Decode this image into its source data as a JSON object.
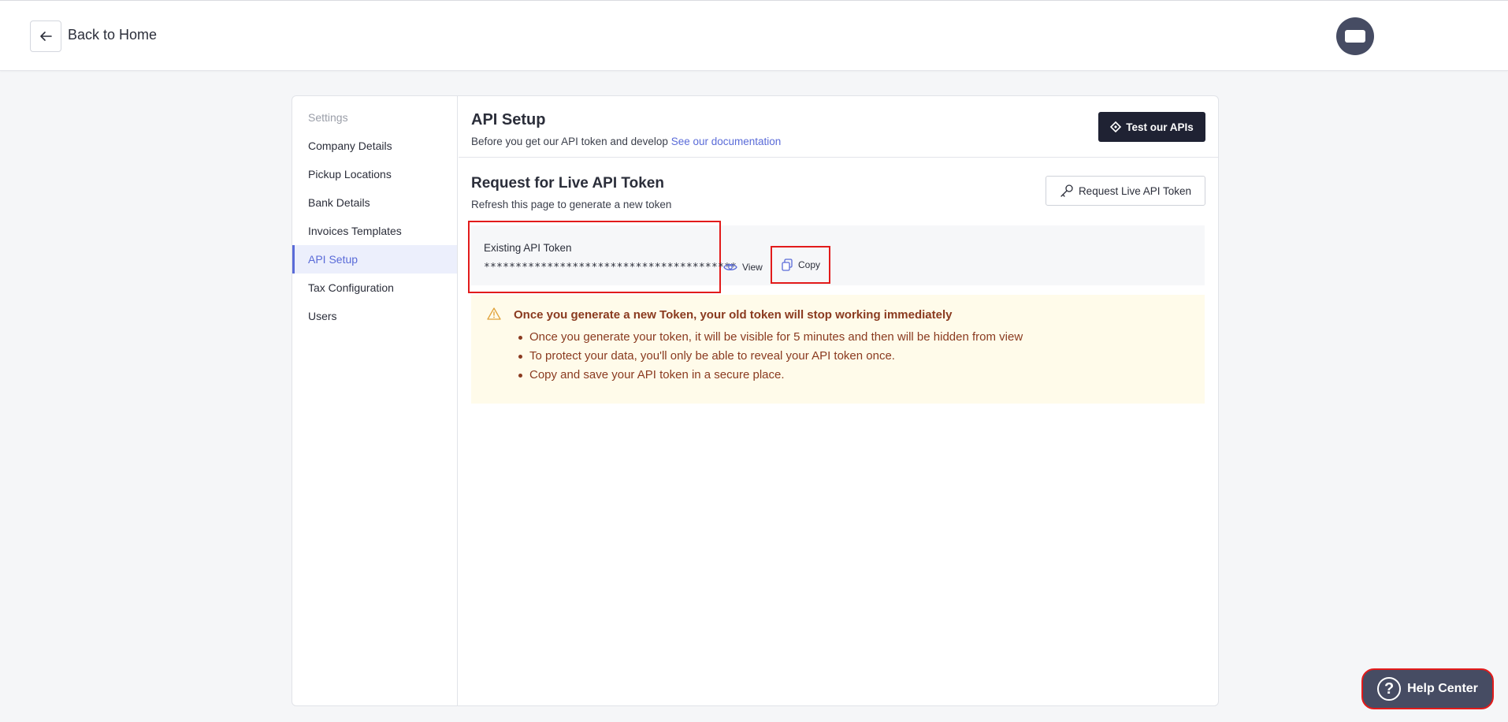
{
  "header": {
    "back_label": "Back to Home"
  },
  "sidebar": {
    "title": "Settings",
    "items": [
      {
        "label": "Company Details"
      },
      {
        "label": "Pickup Locations"
      },
      {
        "label": "Bank Details"
      },
      {
        "label": "Invoices Templates"
      },
      {
        "label": "API Setup"
      },
      {
        "label": "Tax Configuration"
      },
      {
        "label": "Users"
      }
    ],
    "active": "API Setup"
  },
  "api_setup": {
    "title": "API Setup",
    "subtitle": "Before you get our API token and develop",
    "doc_link": "See our documentation",
    "test_button": "Test our APIs"
  },
  "live_token": {
    "title": "Request for Live API Token",
    "subtitle": "Refresh this page to generate a new token",
    "request_button": "Request Live API Token",
    "existing_label": "Existing API Token",
    "token_masked": "****************************************",
    "view_label": "View",
    "copy_label": "Copy"
  },
  "warning": {
    "title": "Once you generate a new Token, your old token will stop working immediately",
    "points": [
      "Once you generate your token, it will be visible for 5 minutes and then will be hidden from view",
      "To protect your data, you'll only be able to reveal your API token once.",
      "Copy and save your API token in a secure place."
    ]
  },
  "help": {
    "label": "Help Center"
  },
  "colors": {
    "accent": "#5a6bd8",
    "dark_button": "#1f2233",
    "highlight_border": "#e21b1b",
    "warning_bg": "#fffbea",
    "warning_text": "#8a3a1f"
  }
}
